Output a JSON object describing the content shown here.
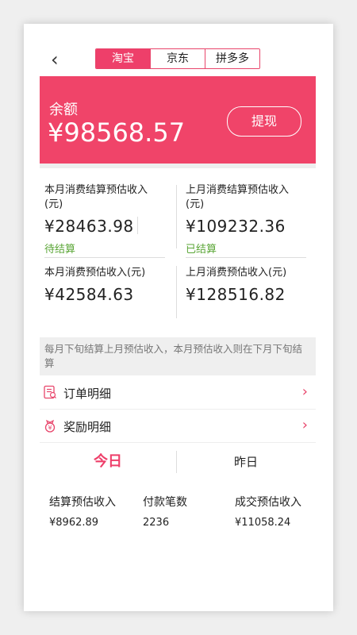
{
  "nav": {
    "back_icon": "chevron-left-icon",
    "tabs": [
      {
        "label": "淘宝",
        "active": true
      },
      {
        "label": "京东",
        "active": false
      },
      {
        "label": "拼多多",
        "active": false
      }
    ]
  },
  "balance": {
    "label": "余额",
    "value": "¥98568.57",
    "withdraw_label": "提现",
    "color": "#f04469"
  },
  "stats": {
    "this_month_settle": {
      "label": "本月消费结算预估收入(元)",
      "value": "¥28463.98",
      "status": "待结算"
    },
    "last_month_settle": {
      "label": "上月消费结算预估收入(元)",
      "value": "¥109232.36",
      "status": "已结算"
    },
    "this_month_est": {
      "label": "本月消费预估收入(元)",
      "value": "¥42584.63"
    },
    "last_month_est": {
      "label": "上月消费预估收入(元)",
      "value": "¥128516.82"
    }
  },
  "notice": "每月下旬结算上月预估收入，本月预估收入则在下月下旬结算",
  "menu": [
    {
      "label": "订单明细",
      "icon": "order-list-icon"
    },
    {
      "label": "奖励明细",
      "icon": "reward-money-icon"
    }
  ],
  "day_tabs": {
    "today": "今日",
    "yesterday": "昨日"
  },
  "daily": [
    {
      "label": "结算预估收入",
      "value": "¥8962.89"
    },
    {
      "label": "付款笔数",
      "value": "2236"
    },
    {
      "label": "成交预估收入",
      "value": "¥11058.24"
    }
  ],
  "colors": {
    "accent": "#ee3f6a",
    "settled_green": "#5aa636"
  }
}
